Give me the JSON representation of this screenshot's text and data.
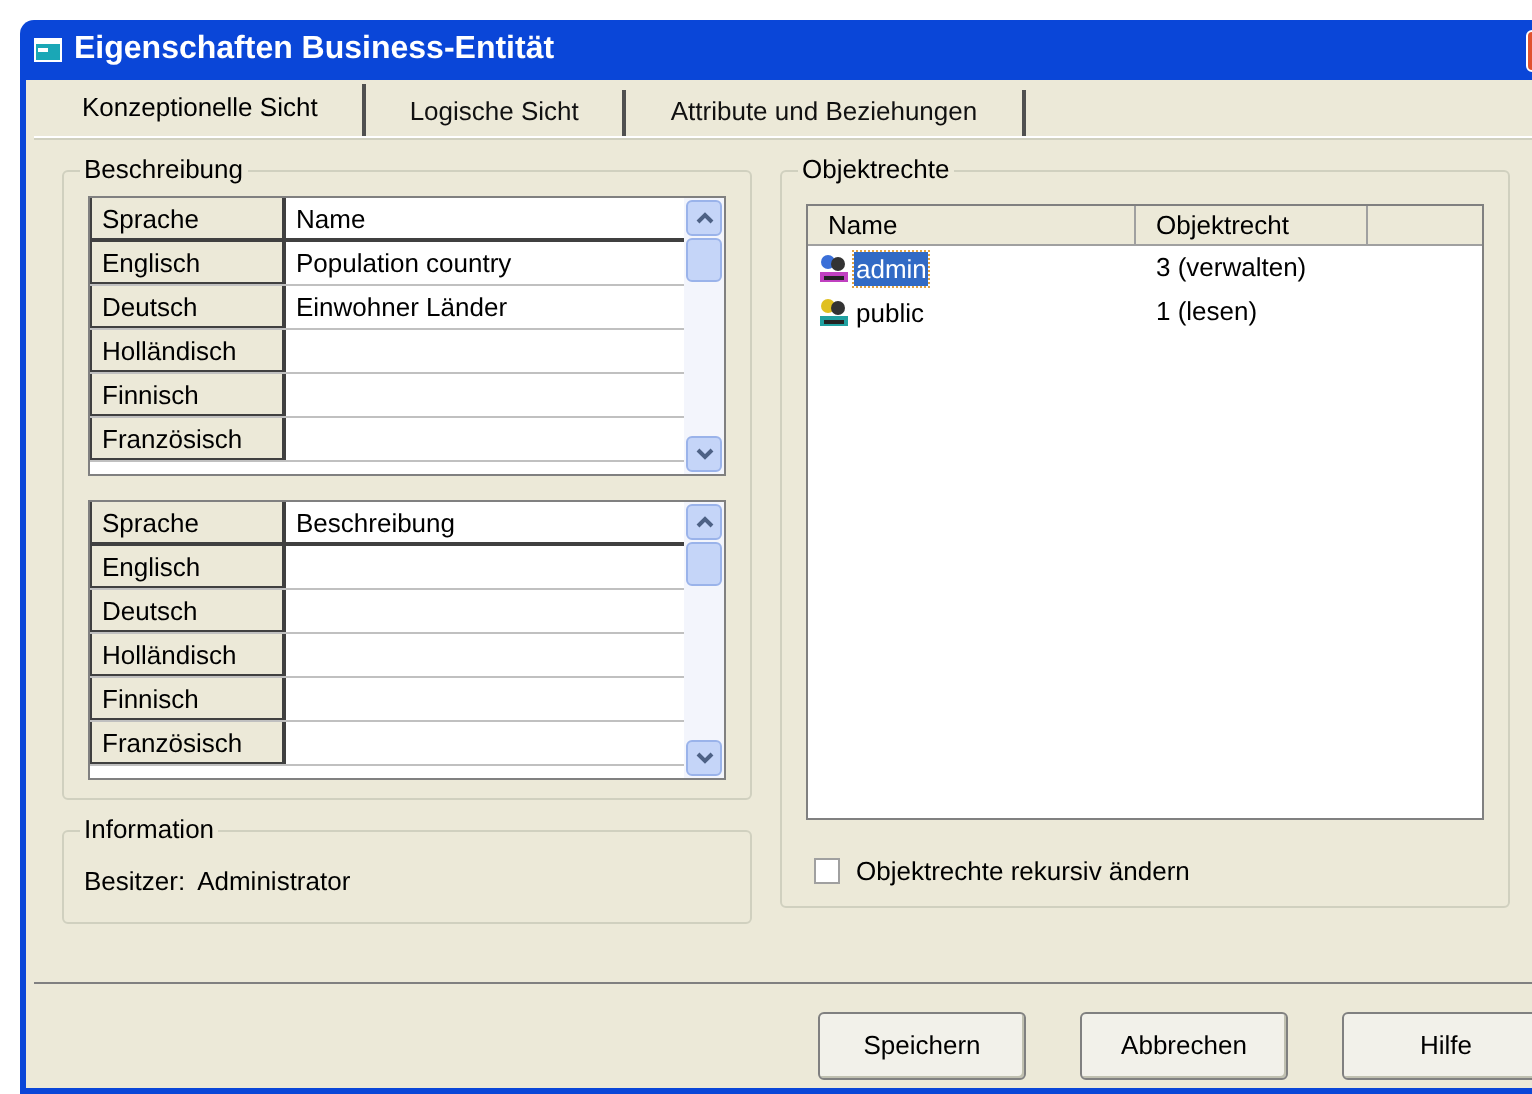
{
  "window": {
    "title": "Eigenschaften Business-Entität"
  },
  "tabs": [
    {
      "label": "Konzeptionelle Sicht",
      "selected": true
    },
    {
      "label": "Logische Sicht",
      "selected": false
    },
    {
      "label": "Attribute und Beziehungen",
      "selected": false
    }
  ],
  "description_group": {
    "title": "Beschreibung",
    "grids": [
      {
        "columns": [
          "Sprache",
          "Name"
        ],
        "rows": [
          {
            "language": "Englisch",
            "value": "Population country"
          },
          {
            "language": "Deutsch",
            "value": "Einwohner Länder"
          },
          {
            "language": "Holländisch"
          },
          {
            "language": "Finnisch"
          },
          {
            "language": "Französisch"
          }
        ]
      },
      {
        "columns": [
          "Sprache",
          "Beschreibung"
        ],
        "rows": [
          {
            "language": "Englisch"
          },
          {
            "language": "Deutsch"
          },
          {
            "language": "Holländisch"
          },
          {
            "language": "Finnisch"
          },
          {
            "language": "Französisch"
          }
        ]
      }
    ]
  },
  "information": {
    "title": "Information",
    "owner_label": "Besitzer:",
    "owner": "Administrator"
  },
  "permissions": {
    "title": "Objektrechte",
    "columns": [
      "Name",
      "Objektrecht"
    ],
    "rows": [
      {
        "kind": "admin",
        "name": "admin",
        "right": "3 (verwalten)",
        "selected": true
      },
      {
        "kind": "group",
        "name": "public",
        "right": "1 (lesen)",
        "selected": false
      }
    ],
    "recursive": {
      "label": "Objektrechte rekursiv ändern",
      "checked": false
    }
  },
  "buttons": [
    "Speichern",
    "Abbrechen",
    "Hilfe"
  ]
}
